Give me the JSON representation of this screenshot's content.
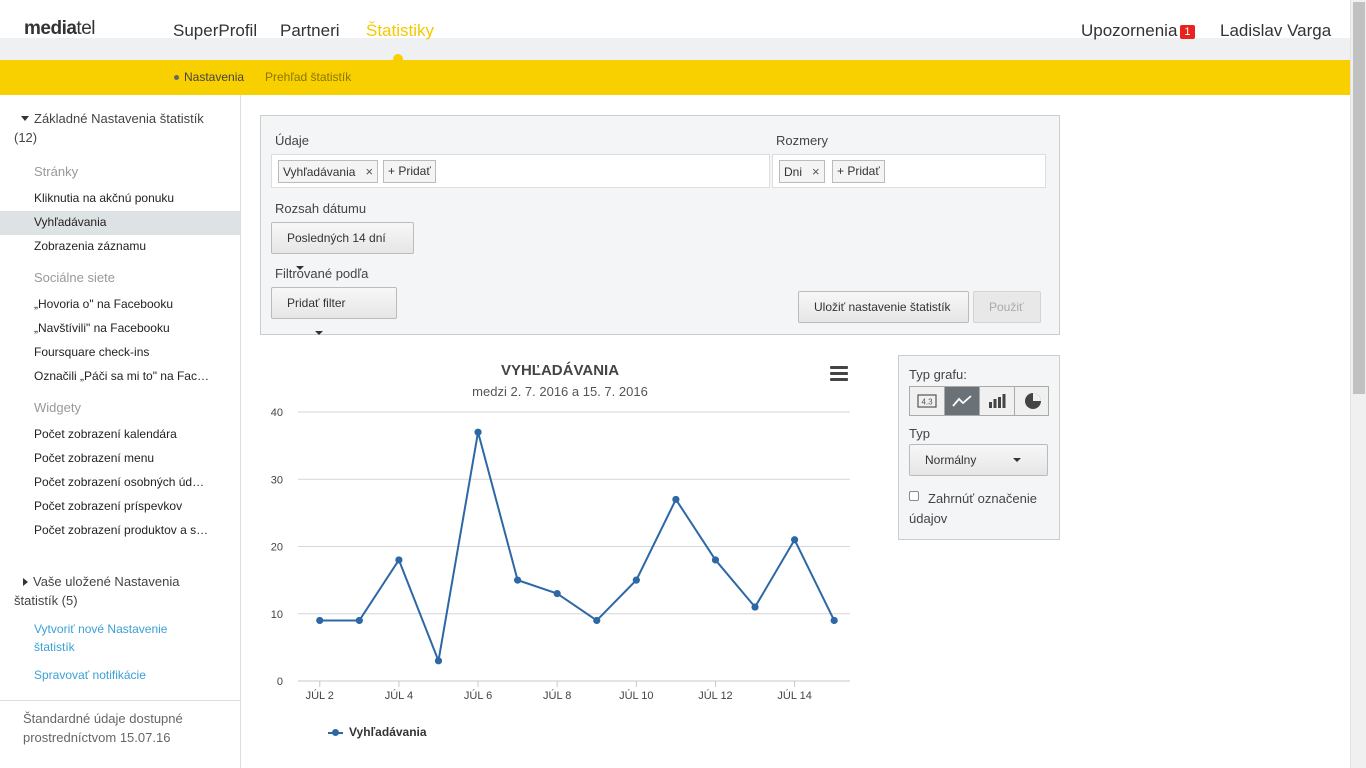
{
  "header": {
    "logo": {
      "part1": "media",
      "part2": "tel"
    },
    "nav": [
      "SuperProfil",
      "Partneri",
      "Štatistiky"
    ],
    "alerts_label": "Upozornenia",
    "alerts_count": "1",
    "user_name": "Ladislav Varga"
  },
  "subnav": {
    "items": [
      "Nastavenia",
      "Prehľad štatistík"
    ]
  },
  "sidebar": {
    "group1": "Základné Nastavenia štatistík (12)",
    "sections": [
      {
        "heading": "Stránky",
        "items": [
          "Kliknutia na akčnú ponuku",
          "Vyhľadávania",
          "Zobrazenia záznamu"
        ]
      },
      {
        "heading": "Sociálne siete",
        "items": [
          "„Hovoria o\" na Facebooku",
          "„Navštívili\" na Facebooku",
          "Foursquare check-ins",
          "Označili „Páči sa mi to\" na Face…"
        ]
      },
      {
        "heading": "Widgety",
        "items": [
          "Počet zobrazení kalendára",
          "Počet zobrazení menu",
          "Počet zobrazení osobných úda…",
          "Počet zobrazení príspevkov",
          "Počet zobrazení produktov a sl…"
        ]
      }
    ],
    "group2": "Vaše uložené Nastavenia štatistík (5)",
    "action_create": "Vytvoriť nové Nastavenie štatistík",
    "action_notifications": "Spravovať notifikácie",
    "footer": "Štandardné údaje dostupné prostredníctvom 15.07.16"
  },
  "settings": {
    "data_label": "Údaje",
    "data_chip": "Vyhľadávania",
    "data_add": "+ Pridať",
    "dims_label": "Rozmery",
    "dims_chip": "Dni",
    "dims_add": "+ Pridať",
    "range_label": "Rozsah dátumu",
    "range_value": "Posledných 14 dní",
    "filter_label": "Filtrované podľa",
    "filter_button": "Pridať filter",
    "save_button": "Uložiť nastavenie štatistík",
    "apply_button": "Použiť",
    "chip_remove_glyph": "×"
  },
  "chart_options": {
    "chart_type_label": "Typ grafu:",
    "type_icons": [
      "table-icon",
      "line-chart-icon",
      "bar-chart-icon",
      "pie-chart-icon"
    ],
    "table_icon_text": "4.3",
    "active_type": "line",
    "type_label": "Typ",
    "type_value": "Normálny",
    "checkbox_label": "Zahrnúť označenie údajov",
    "checkbox_checked": false
  },
  "chart_data": {
    "type": "line",
    "title": "VYHĽADÁVANIA",
    "subtitle": "medzi 2. 7. 2016 a 15. 7. 2016",
    "x": [
      2,
      3,
      4,
      5,
      6,
      7,
      8,
      9,
      10,
      11,
      12,
      13,
      14,
      15
    ],
    "x_tick_values": [
      2,
      4,
      6,
      8,
      10,
      12,
      14
    ],
    "x_tick_labels": [
      "JÚL 2",
      "JÚL 4",
      "JÚL 6",
      "JÚL 8",
      "JÚL 10",
      "JÚL 12",
      "JÚL 14"
    ],
    "series": [
      {
        "name": "Vyhľadávania",
        "values": [
          9,
          9,
          18,
          3,
          37,
          15,
          13,
          9,
          15,
          27,
          18,
          11,
          21,
          9
        ],
        "color": "#2d68a6"
      }
    ],
    "ylim": [
      0,
      40
    ],
    "y_ticks": [
      0,
      10,
      20,
      30,
      40
    ],
    "grid": true,
    "legend": "bottom-left"
  }
}
